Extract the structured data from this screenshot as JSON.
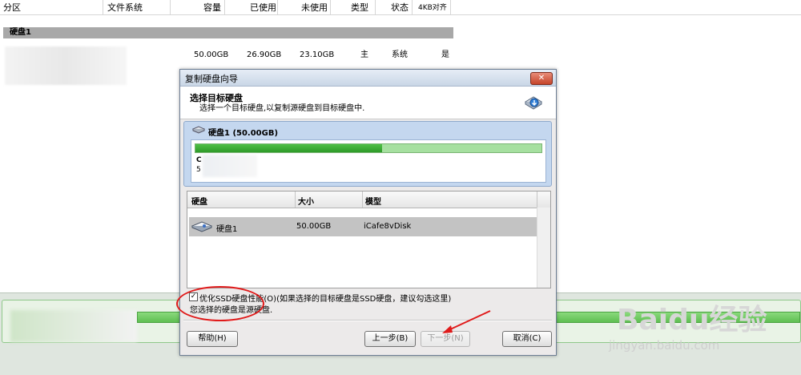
{
  "columns": [
    "分区",
    "文件系统",
    "容量",
    "已使用",
    "未使用",
    "类型",
    "状态",
    "4KB对齐"
  ],
  "disk_label": "硬盘1",
  "partition_row": {
    "capacity": "50.00GB",
    "used": "26.90GB",
    "free": "23.10GB",
    "type": "主",
    "status": "系统",
    "aligned": "是"
  },
  "dialog": {
    "title": "复制硬盘向导",
    "close_label": "✕",
    "header_title": "选择目标硬盘",
    "header_subtitle": "选择一个目标硬盘,以复制源硬盘到目标硬盘中.",
    "source_disk_label": "硬盘1 (50.00GB)",
    "source_used_fraction": 0.54,
    "source_partition_letter": "C",
    "source_partition_size": "5",
    "table": {
      "headers": [
        "硬盘",
        "大小",
        "模型"
      ],
      "rows": [
        {
          "disk": "硬盘1",
          "size": "50.00GB",
          "model": "iCafe8vDisk"
        }
      ]
    },
    "ssd_checkbox_checked": true,
    "ssd_checkbox_label": "优化SSD硬盘性能(O)(如果选择的目标硬盘是SSD硬盘，建议勾选这里)",
    "info_message": "您选择的硬盘是源硬盘.",
    "buttons": {
      "help": "帮助(H)",
      "back": "上一步(B)",
      "next": "下一步(N)",
      "cancel": "取消(C)"
    }
  },
  "watermark": {
    "brand": "Baidu经验",
    "url": "jingyan.baidu.com"
  },
  "colors": {
    "accent_green": "#3fae38",
    "highlight_red": "#e01b1b",
    "selection_blue": "#c4d7ef"
  }
}
